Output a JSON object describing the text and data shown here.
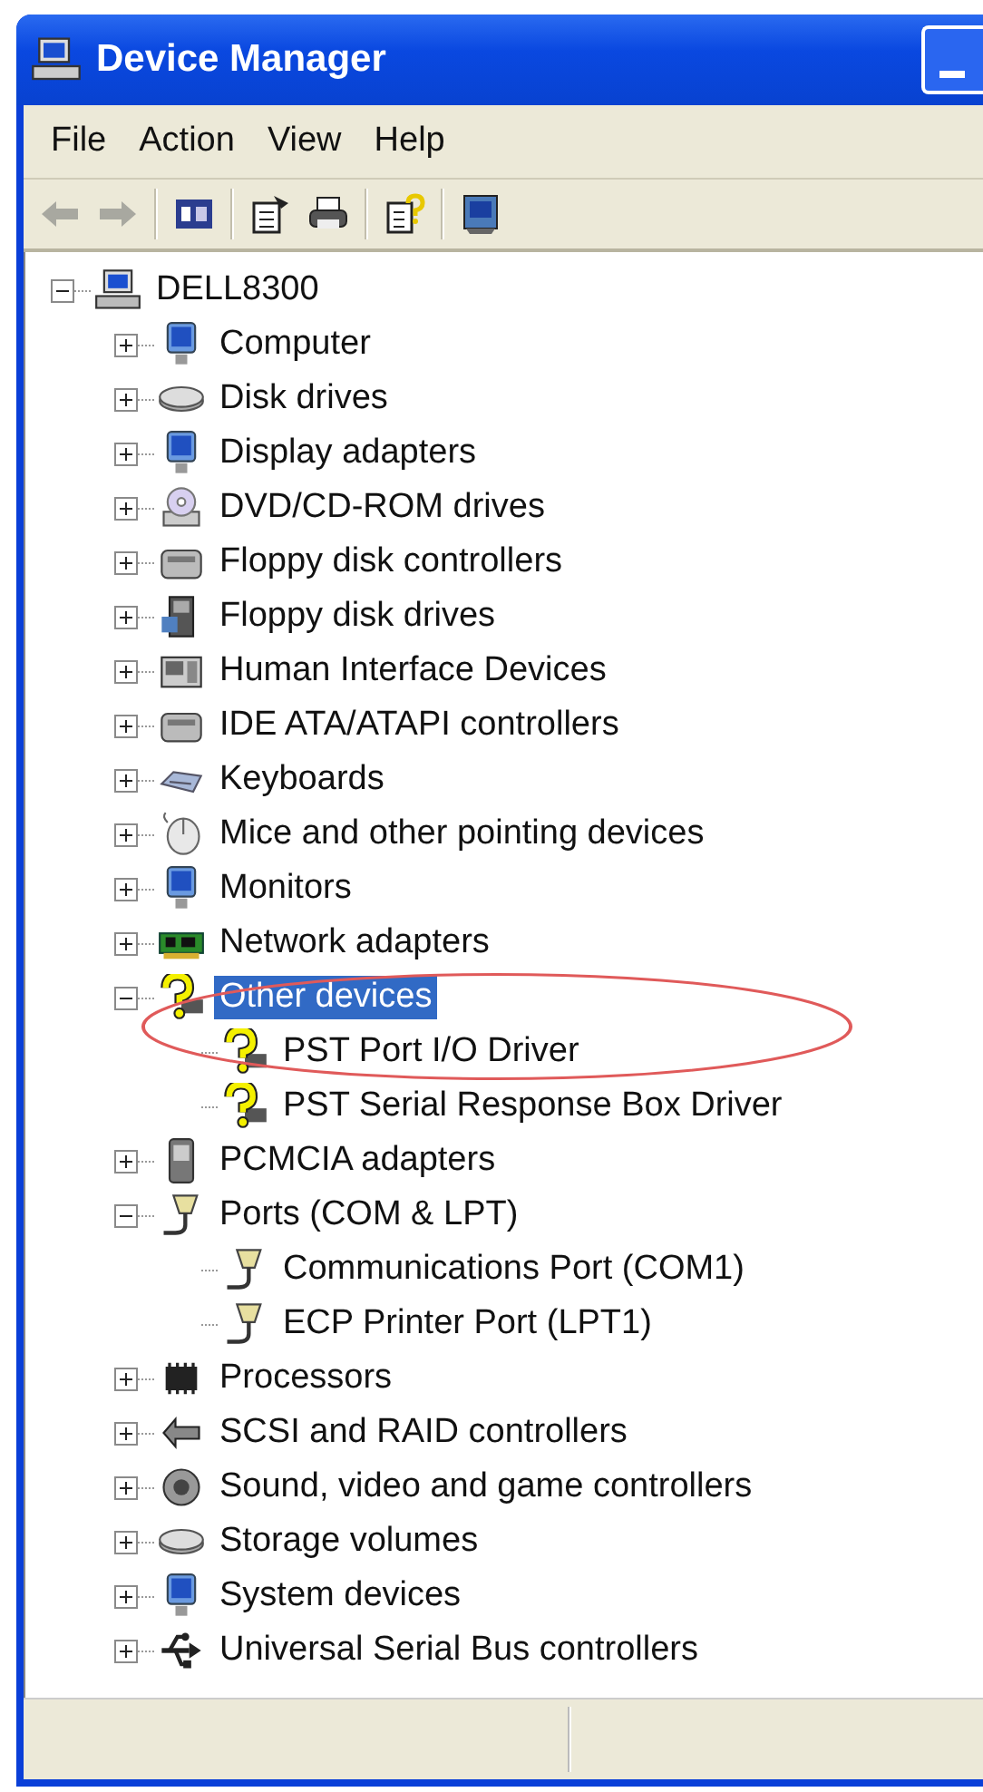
{
  "window": {
    "title": "Device Manager"
  },
  "menu": [
    {
      "label": "File"
    },
    {
      "label": "Action"
    },
    {
      "label": "View"
    },
    {
      "label": "Help"
    }
  ],
  "toolbar": [
    {
      "kind": "back",
      "disabled": true
    },
    {
      "kind": "forward",
      "disabled": true
    },
    {
      "kind": "separator"
    },
    {
      "kind": "console",
      "disabled": false
    },
    {
      "kind": "separator"
    },
    {
      "kind": "properties",
      "disabled": false
    },
    {
      "kind": "print",
      "disabled": false
    },
    {
      "kind": "separator"
    },
    {
      "kind": "help",
      "disabled": false
    },
    {
      "kind": "separator"
    },
    {
      "kind": "scan",
      "disabled": false
    }
  ],
  "tree": [
    {
      "label": "DELL8300",
      "kind": "computer",
      "expanded": true,
      "selected": false,
      "children": [
        {
          "label": "Computer",
          "kind": "monitor",
          "expanded": false,
          "selected": false
        },
        {
          "label": "Disk drives",
          "kind": "disk",
          "expanded": false,
          "selected": false
        },
        {
          "label": "Display adapters",
          "kind": "monitor",
          "expanded": false,
          "selected": false
        },
        {
          "label": "DVD/CD-ROM drives",
          "kind": "cdrom",
          "expanded": false,
          "selected": false
        },
        {
          "label": "Floppy disk controllers",
          "kind": "controller",
          "expanded": false,
          "selected": false
        },
        {
          "label": "Floppy disk drives",
          "kind": "floppy",
          "expanded": false,
          "selected": false
        },
        {
          "label": "Human Interface Devices",
          "kind": "hid",
          "expanded": false,
          "selected": false
        },
        {
          "label": "IDE ATA/ATAPI controllers",
          "kind": "controller",
          "expanded": false,
          "selected": false
        },
        {
          "label": "Keyboards",
          "kind": "keyboard",
          "expanded": false,
          "selected": false
        },
        {
          "label": "Mice and other pointing devices",
          "kind": "mouse",
          "expanded": false,
          "selected": false
        },
        {
          "label": "Monitors",
          "kind": "monitor",
          "expanded": false,
          "selected": false
        },
        {
          "label": "Network adapters",
          "kind": "network",
          "expanded": false,
          "selected": false
        },
        {
          "label": "Other devices",
          "kind": "unknown",
          "expanded": true,
          "selected": true,
          "children": [
            {
              "label": "PST Port I/O Driver",
              "kind": "unknown",
              "selected": false
            },
            {
              "label": "PST Serial Response Box Driver",
              "kind": "unknown",
              "selected": false
            }
          ]
        },
        {
          "label": "PCMCIA adapters",
          "kind": "pcmcia",
          "expanded": false,
          "selected": false
        },
        {
          "label": "Ports (COM & LPT)",
          "kind": "port",
          "expanded": true,
          "selected": false,
          "children": [
            {
              "label": "Communications Port (COM1)",
              "kind": "port",
              "selected": false
            },
            {
              "label": "ECP Printer Port (LPT1)",
              "kind": "port",
              "selected": false
            }
          ]
        },
        {
          "label": "Processors",
          "kind": "chip",
          "expanded": false,
          "selected": false
        },
        {
          "label": "SCSI and RAID controllers",
          "kind": "scsi",
          "expanded": false,
          "selected": false
        },
        {
          "label": "Sound, video and game controllers",
          "kind": "sound",
          "expanded": false,
          "selected": false
        },
        {
          "label": "Storage volumes",
          "kind": "disk",
          "expanded": false,
          "selected": false
        },
        {
          "label": "System devices",
          "kind": "monitor",
          "expanded": false,
          "selected": false
        },
        {
          "label": "Universal Serial Bus controllers",
          "kind": "usb",
          "expanded": false,
          "selected": false
        }
      ]
    }
  ]
}
